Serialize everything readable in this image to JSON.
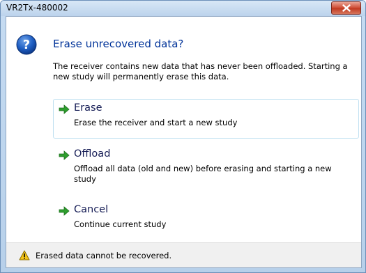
{
  "window": {
    "title": "VR2Tx-480002",
    "close_icon": "close-icon"
  },
  "dialog": {
    "icon": "question-icon",
    "heading": "Erase unrecovered data?",
    "description": "The receiver contains new data that has never been offloaded. Starting a new study will permanently erase this data."
  },
  "commands": [
    {
      "title": "Erase",
      "description": "Erase the receiver and start a new study",
      "icon": "green-arrow-icon",
      "selected": true
    },
    {
      "title": "Offload",
      "description": "Offload all data (old and new) before erasing and starting a new study",
      "icon": "green-arrow-icon",
      "selected": false
    },
    {
      "title": "Cancel",
      "description": "Continue current study",
      "icon": "green-arrow-icon",
      "selected": false
    }
  ],
  "footer": {
    "icon": "warning-icon",
    "text": "Erased data cannot be recovered."
  },
  "colors": {
    "heading": "#003399",
    "command_title": "#151c55",
    "arrow": "#2e9e2e",
    "close_button": "#c0381f"
  }
}
